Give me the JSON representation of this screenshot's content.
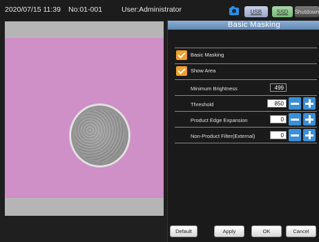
{
  "status_bar": {
    "date_time": "2020/07/15  11:39",
    "number": "No:01-001",
    "user": "User:Administrator",
    "usb_label": "USB",
    "ssd_label": "SSD",
    "shutdown_label": "Shutdown"
  },
  "panel": {
    "title": "Basic Masking",
    "checkboxes": [
      {
        "label": "Basic Masking",
        "checked": true
      },
      {
        "label": "Show Area",
        "checked": true
      }
    ],
    "params": [
      {
        "label": "Minimum Brightness",
        "value": "499"
      },
      {
        "label": "Threshold",
        "value": "850"
      },
      {
        "label": "Product Edge Expansion",
        "value": "0"
      },
      {
        "label": "Non-Product Filter(External)",
        "value": "0"
      }
    ]
  },
  "footer": {
    "default_label": "Default",
    "apply_label": "Apply",
    "ok_label": "OK",
    "cancel_label": "Cancel"
  },
  "colors": {
    "accent_blue": "#3a8fd8",
    "checkbox_orange": "#f0a030",
    "image_pink": "#cf8fc7"
  }
}
